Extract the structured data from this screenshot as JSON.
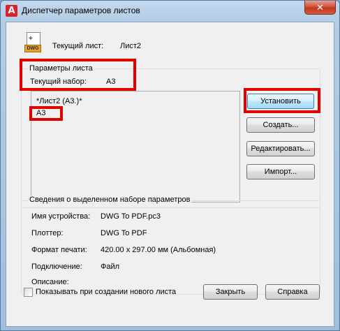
{
  "window": {
    "title": "Диспетчер параметров листов",
    "app_icon": "A",
    "close_glyph": "✕"
  },
  "current_sheet": {
    "icon_tag": "DWG",
    "label": "Текущий лист:",
    "value": "Лист2"
  },
  "page_setups": {
    "group_title": "Параметры листа",
    "current_set_label": "Текущий набор:",
    "current_set_value": "А3",
    "list_items": [
      "*Лист2 (А3.)*",
      "А3"
    ]
  },
  "buttons": {
    "set_current": "Установить",
    "new": "Создать...",
    "modify": "Редактировать...",
    "import": "Импорт..."
  },
  "details": {
    "group_title": "Сведения о выделенном наборе параметров",
    "rows": [
      {
        "label": "Имя устройства:",
        "value": "DWG To PDF.pc3"
      },
      {
        "label": "Плоттер:",
        "value": "DWG To PDF"
      },
      {
        "label": "Формат печати:",
        "value": "420.00 x 297.00 мм (Альбомная)"
      },
      {
        "label": "Подключение:",
        "value": "Файл"
      },
      {
        "label": "Описание:",
        "value": ""
      }
    ]
  },
  "footer": {
    "show_on_new_label": "Показывать при создании нового листа",
    "show_on_new_checked": false,
    "close_label": "Закрыть",
    "help_label": "Справка"
  },
  "colors": {
    "highlight": "#e00000",
    "close_button": "#c0391f"
  }
}
